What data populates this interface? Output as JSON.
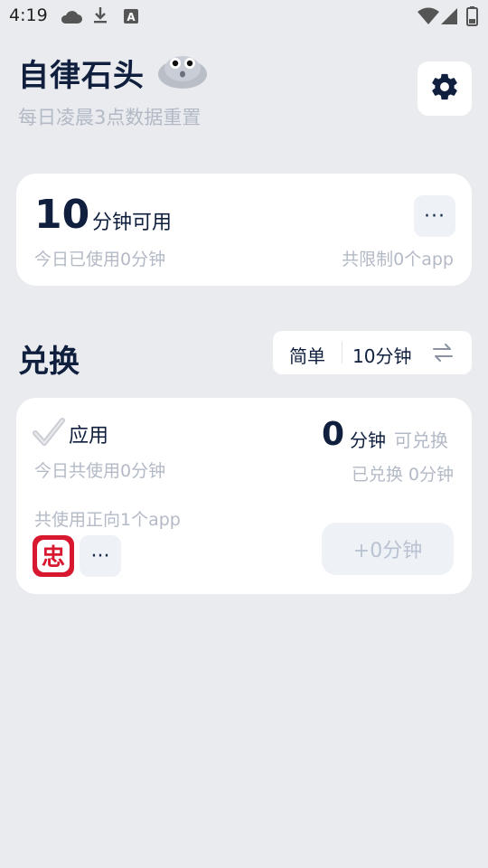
{
  "status_bar": {
    "time": "4:19",
    "icons": [
      "cloud-icon",
      "download-icon",
      "a-icon",
      "wifi-icon",
      "cellular-icon",
      "battery-icon"
    ]
  },
  "header": {
    "title": "自律石头",
    "subtitle": "每日凌晨3点数据重置",
    "settings_icon": "gear-icon"
  },
  "summary": {
    "minutes": "10",
    "minutes_label": "分钟可用",
    "more_label": "···",
    "used_today": "今日已使用0分钟",
    "limited_apps": "共限制0个app"
  },
  "exchange_section": {
    "title": "兑换",
    "mode": "简单",
    "mode_value": "10分钟"
  },
  "exchange_card": {
    "label": "应用",
    "minutes": "0",
    "unit": "分钟",
    "available_label": "可兑换",
    "used_today": "今日共使用0分钟",
    "redeemed": "已兑换 0分钟",
    "app_count": "共使用正向1个app",
    "app_icon_glyph": "忠",
    "more_label": "···",
    "add_button": "+0分钟"
  },
  "colors": {
    "background": "#e9ebee",
    "primary_text": "#0f1f3d",
    "muted_text": "#b3bac6",
    "app_icon": "#d8182f"
  }
}
